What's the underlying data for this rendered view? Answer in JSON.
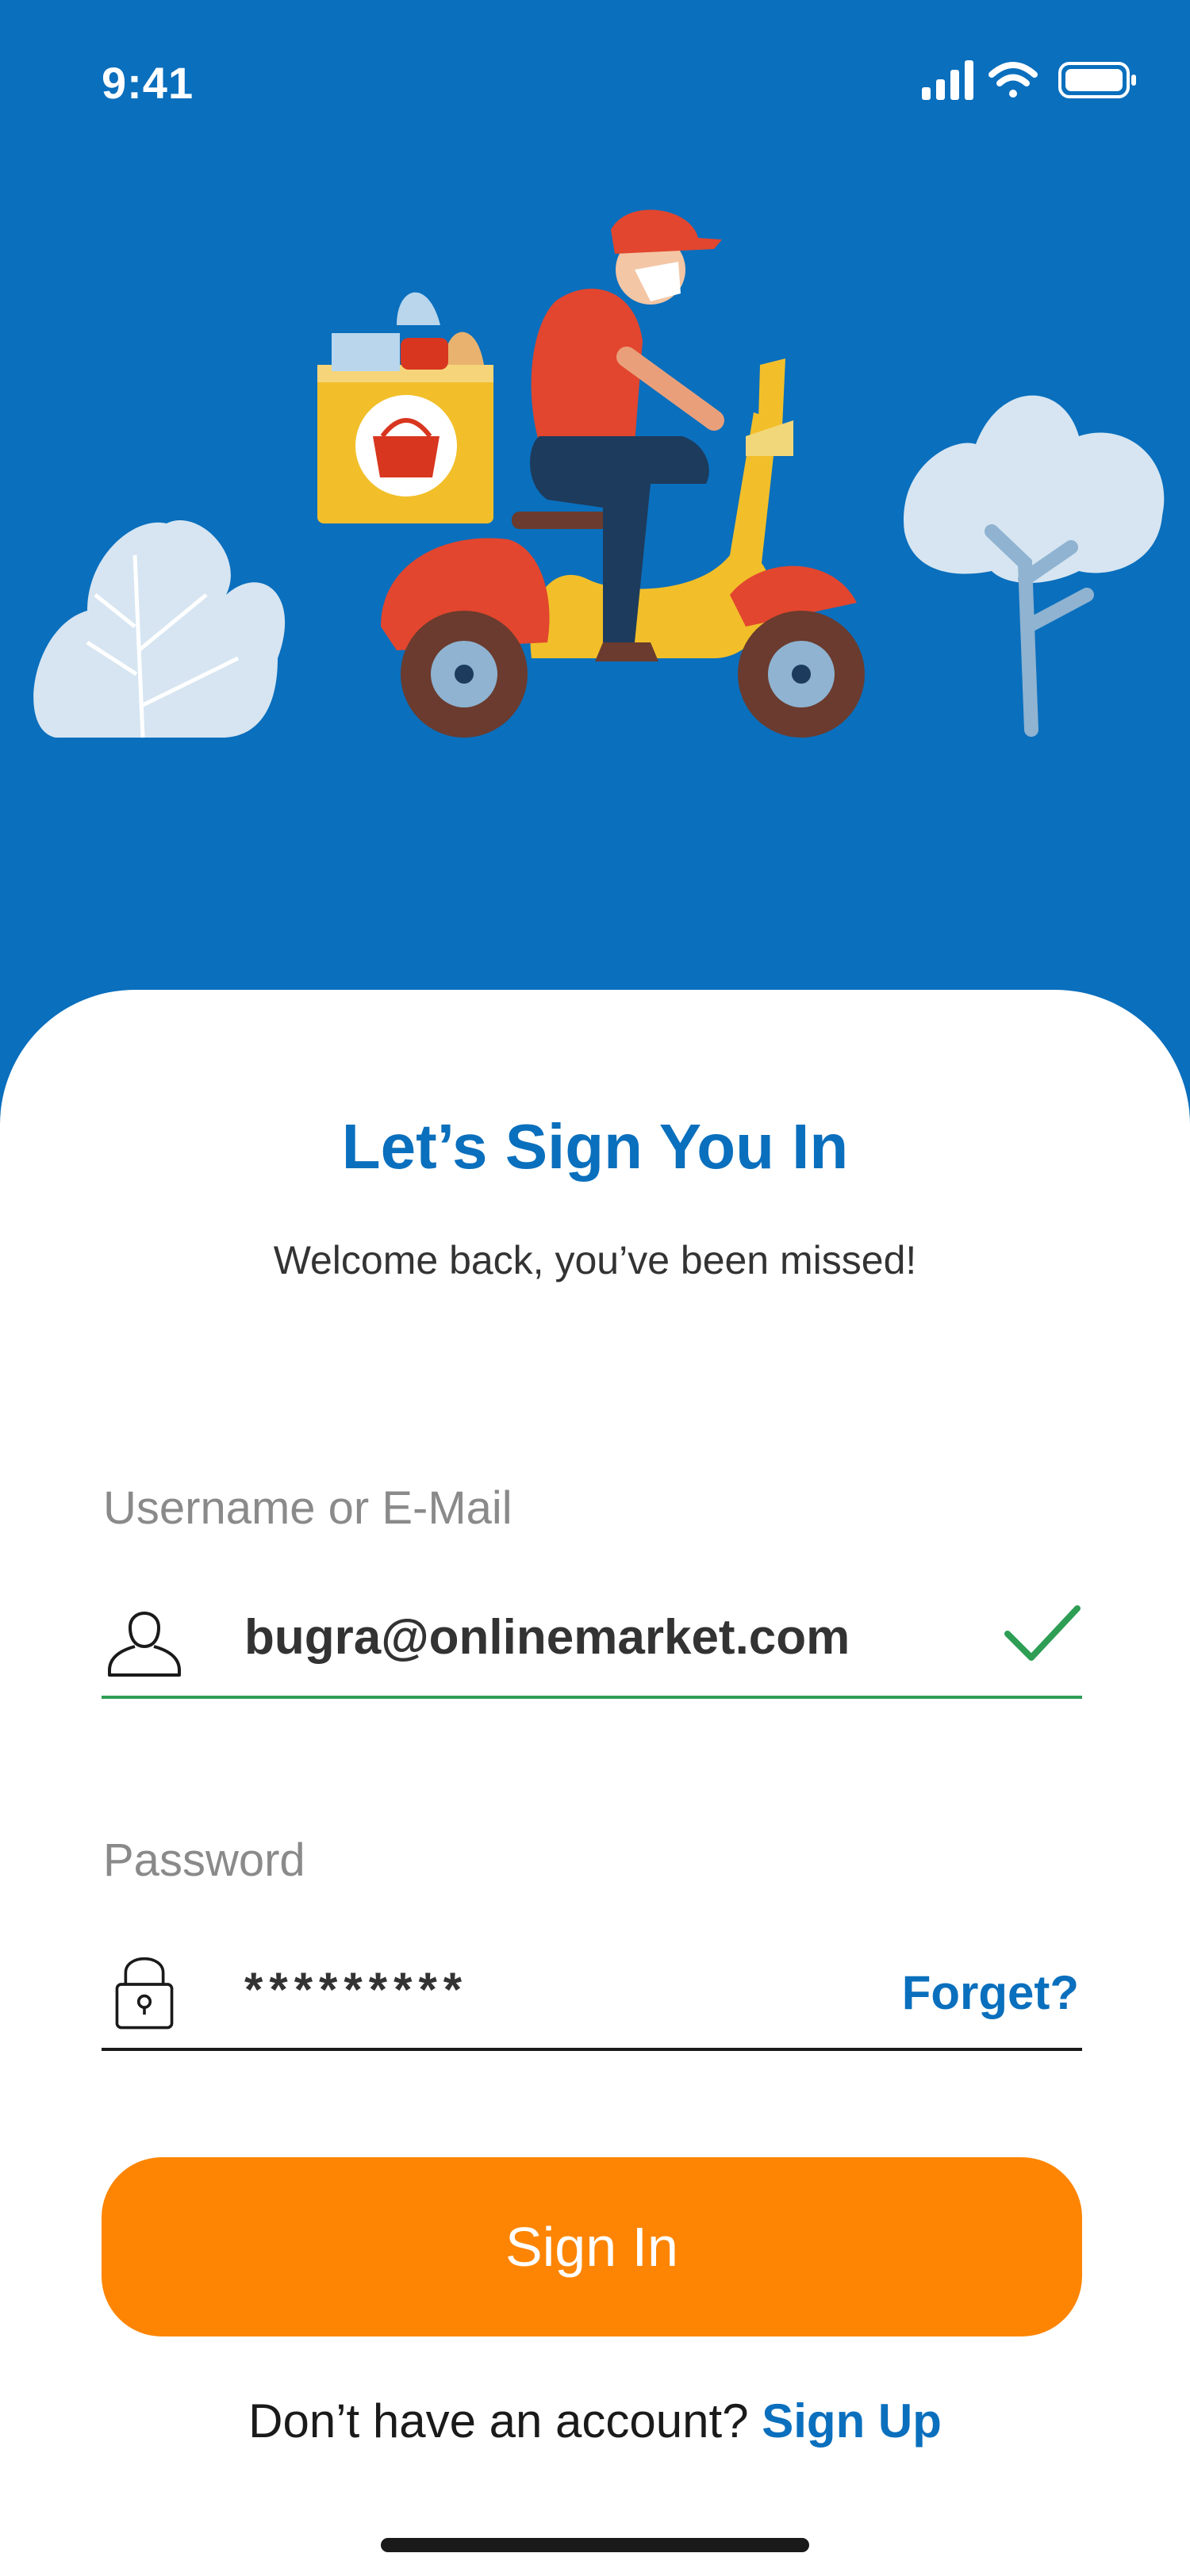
{
  "status_bar": {
    "time": "9:41"
  },
  "sign_in": {
    "title": "Let’s Sign You In",
    "subtitle": "Welcome back, you’ve been missed!"
  },
  "username_field": {
    "label": "Username or E-Mail",
    "value": "bugra@onlinemarket.com",
    "valid": true
  },
  "password_field": {
    "label": "Password",
    "value": "*********",
    "forget_label": "Forget?"
  },
  "actions": {
    "sign_in_label": "Sign In",
    "no_account_text": "Don’t have an account?",
    "sign_up_label": "Sign Up"
  },
  "colors": {
    "primary_blue": "#0a6fbd",
    "button_orange": "#fd8503",
    "valid_green": "#2e9e55",
    "label_gray": "#8a8a8a"
  },
  "icons": {
    "username": "user-icon",
    "password": "lock-icon",
    "validation": "check-icon"
  }
}
